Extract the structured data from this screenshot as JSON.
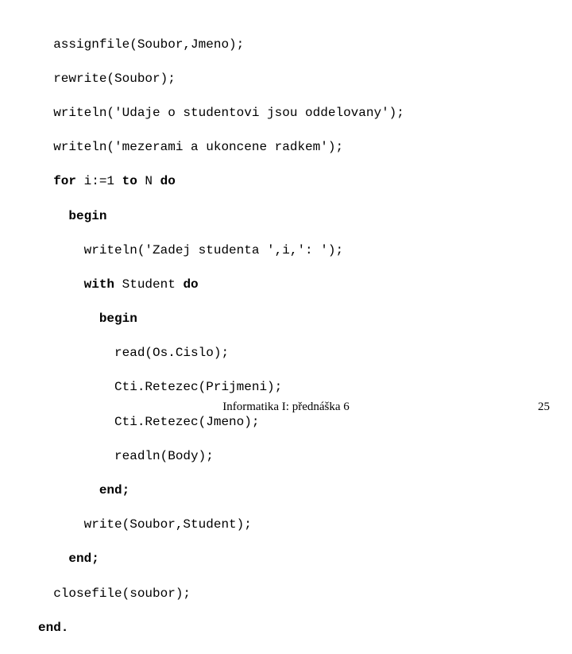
{
  "code": {
    "l1": "assignfile(Soubor,Jmeno);",
    "l2": "rewrite(Soubor);",
    "l3": "writeln('Udaje o studentovi jsou oddelovany');",
    "l4": "writeln('mezerami a ukoncene radkem');",
    "l5a": "for",
    "l5b": " i:=1 ",
    "l5c": "to",
    "l5d": " N ",
    "l5e": "do",
    "l6": "begin",
    "l7": "writeln('Zadej studenta ',i,': ');",
    "l8a": "with",
    "l8b": " Student ",
    "l8c": "do",
    "l9": "begin",
    "l10": "read(Os.Cislo);",
    "l11": "Cti.Retezec(Prijmeni);",
    "l12": "Cti.Retezec(Jmeno);",
    "l13": "readln(Body);",
    "l14": "end;",
    "l15": "write(Soubor,Student);",
    "l16": "end;",
    "l17": "closefile(soubor);",
    "l18": "end."
  },
  "footer": {
    "title": "Informatika I: přednáška 6",
    "page": "25"
  }
}
